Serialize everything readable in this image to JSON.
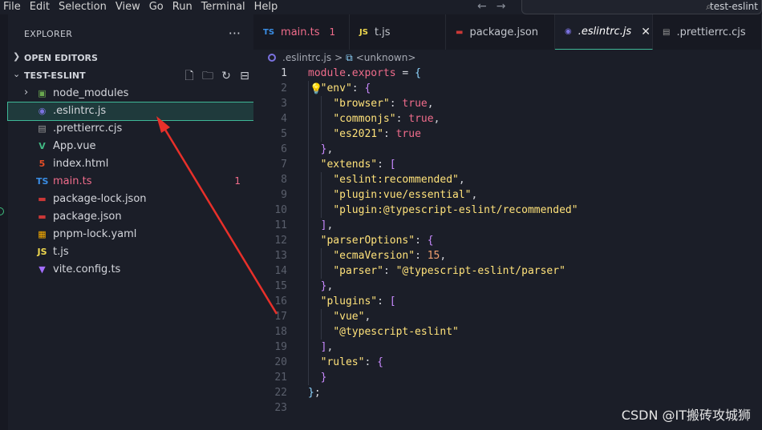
{
  "menu": [
    "File",
    "Edit",
    "Selection",
    "View",
    "Go",
    "Run",
    "Terminal",
    "Help"
  ],
  "search": {
    "text": "test-eslint"
  },
  "sidebar": {
    "title": "EXPLORER",
    "open_editors": "OPEN EDITORS",
    "project": "TEST-ESLINT",
    "files": [
      {
        "name": "node_modules",
        "icon": "folder-node-icon",
        "glyph": "▣",
        "color": "#6aa84f",
        "folder": true
      },
      {
        "name": ".eslintrc.js",
        "icon": "eslint-icon",
        "glyph": "◉",
        "color": "#7b72e0",
        "selected": true
      },
      {
        "name": ".prettierrc.cjs",
        "icon": "prettier-icon",
        "glyph": "▤",
        "color": "#9a9a9a"
      },
      {
        "name": "App.vue",
        "icon": "vue-icon",
        "glyph": "V",
        "color": "#41b883"
      },
      {
        "name": "index.html",
        "icon": "html-icon",
        "glyph": "5",
        "color": "#e44d26"
      },
      {
        "name": "main.ts",
        "icon": "typescript-icon",
        "glyph": "TS",
        "color": "#3a8ee6",
        "badge": "1",
        "error": true
      },
      {
        "name": "package-lock.json",
        "icon": "npm-icon",
        "glyph": "▬",
        "color": "#cb3837"
      },
      {
        "name": "package.json",
        "icon": "npm-icon",
        "glyph": "▬",
        "color": "#cb3837"
      },
      {
        "name": "pnpm-lock.yaml",
        "icon": "pnpm-icon",
        "glyph": "▦",
        "color": "#f9ad00"
      },
      {
        "name": "t.js",
        "icon": "js-icon",
        "glyph": "JS",
        "color": "#f0d94f"
      },
      {
        "name": "vite.config.ts",
        "icon": "vite-icon",
        "glyph": "▼",
        "color": "#a36dff"
      }
    ]
  },
  "tabs": [
    {
      "label": "main.ts",
      "icon": "TS",
      "color": "#3a8ee6",
      "badge": "1",
      "error": true
    },
    {
      "label": "t.js",
      "icon": "JS",
      "color": "#f0d94f"
    },
    {
      "label": "package.json",
      "icon": "▬",
      "color": "#cb3837"
    },
    {
      "label": ".eslintrc.js",
      "icon": "◉",
      "color": "#7b72e0",
      "active": true
    },
    {
      "label": ".prettierrc.cjs",
      "icon": "▤",
      "color": "#9a9a9a"
    }
  ],
  "breadcrumb": {
    "file": ".eslintrc.js",
    "sep": ">",
    "symbol": "<unknown>"
  },
  "code_lines": [
    "module.exports = {",
    "  \"env\": {",
    "    \"browser\": true,",
    "    \"commonjs\": true,",
    "    \"es2021\": true",
    "  },",
    "  \"extends\": [",
    "    \"eslint:recommended\",",
    "    \"plugin:vue/essential\",",
    "    \"plugin:@typescript-eslint/recommended\"",
    "  ],",
    "  \"parserOptions\": {",
    "    \"ecmaVersion\": 15,",
    "    \"parser\": \"@typescript-eslint/parser\"",
    "  },",
    "  \"plugins\": [",
    "    \"vue\",",
    "    \"@typescript-eslint\"",
    "  ],",
    "  \"rules\": {",
    "  }",
    "};",
    ""
  ],
  "watermark": "CSDN @IT搬砖攻城狮",
  "colors": {
    "accent": "#3fb897",
    "keyword": "#f06c8b",
    "string": "#ffe27a",
    "arrow": "#e8302a"
  }
}
